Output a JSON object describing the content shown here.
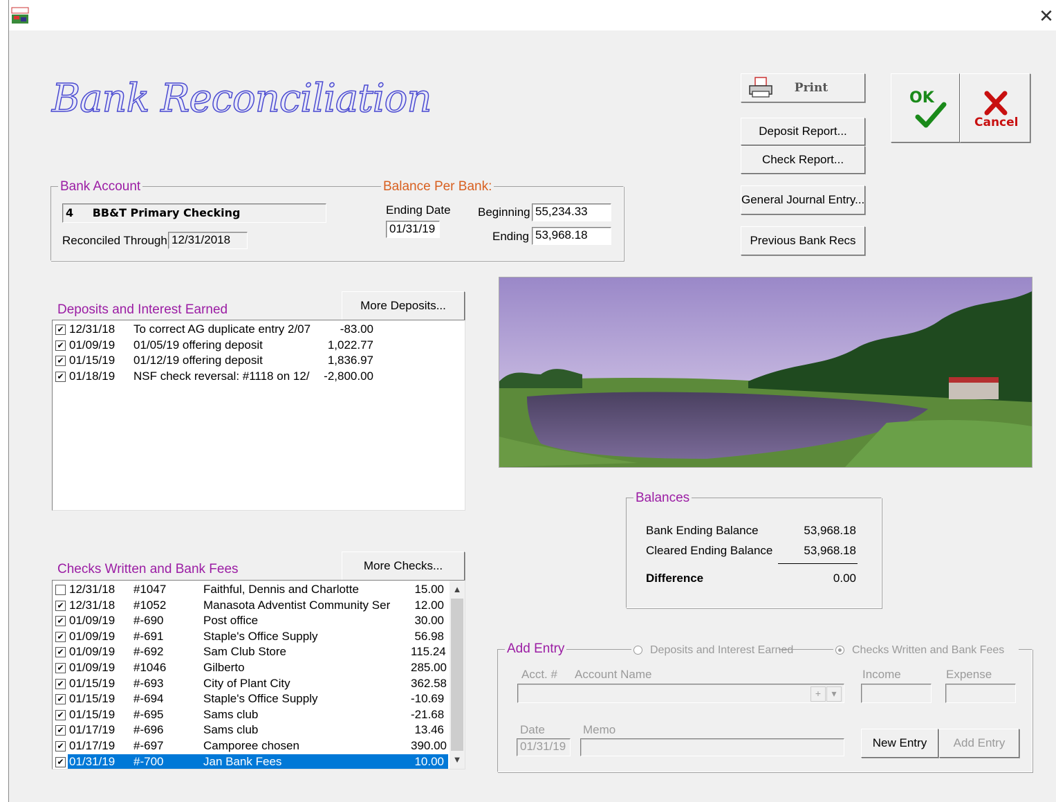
{
  "window": {
    "title": "Bank Reconciliation",
    "close_glyph": "✕"
  },
  "bank_account": {
    "legend": "Bank Account",
    "number": "4",
    "name": "BB&T Primary Checking",
    "reconciled_label": "Reconciled Through",
    "reconciled_value": "12/31/2018"
  },
  "balance_per_bank": {
    "legend": "Balance Per Bank:",
    "ending_date_label": "Ending Date",
    "ending_date_value": "01/31/19",
    "beginning_label": "Beginning",
    "beginning_value": "55,234.33",
    "ending_label": "Ending",
    "ending_value": "53,968.18"
  },
  "buttons": {
    "print": "Print",
    "deposit_report": "Deposit Report...",
    "check_report": "Check Report...",
    "general_journal": "General Journal Entry...",
    "previous_recs": "Previous Bank Recs",
    "ok": "OK",
    "cancel": "Cancel",
    "more_deposits": "More Deposits...",
    "more_checks": "More Checks...",
    "new_entry": "New Entry",
    "add_entry": "Add Entry"
  },
  "deposits": {
    "title": "Deposits and Interest Earned",
    "rows": [
      {
        "checked": true,
        "date": "12/31/18",
        "desc": "To correct AG duplicate entry 2/07",
        "amount": "-83.00"
      },
      {
        "checked": true,
        "date": "01/09/19",
        "desc": "01/05/19 offering deposit",
        "amount": "1,022.77"
      },
      {
        "checked": true,
        "date": "01/15/19",
        "desc": "01/12/19 offering deposit",
        "amount": "1,836.97"
      },
      {
        "checked": true,
        "date": "01/18/19",
        "desc": "NSF check reversal: #1118 on 12/",
        "amount": "-2,800.00"
      }
    ]
  },
  "checks": {
    "title": "Checks Written and Bank Fees",
    "rows": [
      {
        "checked": false,
        "date": "12/31/18",
        "num": "#1047",
        "payee": "Faithful, Dennis and Charlotte",
        "amount": "15.00"
      },
      {
        "checked": true,
        "date": "12/31/18",
        "num": "#1052",
        "payee": "Manasota Adventist Community Ser",
        "amount": "12.00"
      },
      {
        "checked": true,
        "date": "01/09/19",
        "num": "#-690",
        "payee": "Post office",
        "amount": "30.00"
      },
      {
        "checked": true,
        "date": "01/09/19",
        "num": "#-691",
        "payee": "Staple's Office Supply",
        "amount": "56.98"
      },
      {
        "checked": true,
        "date": "01/09/19",
        "num": "#-692",
        "payee": "Sam Club Store",
        "amount": "115.24"
      },
      {
        "checked": true,
        "date": "01/09/19",
        "num": "#1046",
        "payee": "Gilberto",
        "amount": "285.00"
      },
      {
        "checked": true,
        "date": "01/15/19",
        "num": "#-693",
        "payee": "City of Plant City",
        "amount": "362.58"
      },
      {
        "checked": true,
        "date": "01/15/19",
        "num": "#-694",
        "payee": "Staple's Office Supply",
        "amount": "-10.69"
      },
      {
        "checked": true,
        "date": "01/15/19",
        "num": "#-695",
        "payee": "Sams club",
        "amount": "-21.68"
      },
      {
        "checked": true,
        "date": "01/17/19",
        "num": "#-696",
        "payee": "Sams club",
        "amount": "13.46"
      },
      {
        "checked": true,
        "date": "01/17/19",
        "num": "#-697",
        "payee": "Camporee chosen",
        "amount": "390.00"
      },
      {
        "checked": true,
        "date": "01/31/19",
        "num": "#-700",
        "payee": "Jan Bank Fees",
        "amount": "10.00",
        "selected": true
      }
    ]
  },
  "balances": {
    "legend": "Balances",
    "bank_ending_label": "Bank Ending Balance",
    "bank_ending_value": "53,968.18",
    "cleared_ending_label": "Cleared Ending Balance",
    "cleared_ending_value": "53,968.18",
    "difference_label": "Difference",
    "difference_value": "0.00"
  },
  "add_entry": {
    "legend": "Add Entry",
    "radio_deposits": "Deposits and Interest Earned",
    "radio_checks": "Checks Written and Bank Fees",
    "acct_label": "Acct. #",
    "account_name_label": "Account Name",
    "income_label": "Income",
    "expense_label": "Expense",
    "date_label": "Date",
    "date_value": "01/31/19",
    "memo_label": "Memo",
    "plus_glyph": "+",
    "dropdown_glyph": "▾"
  },
  "colors": {
    "legend_purple": "#9b1da4",
    "legend_orange": "#d86020",
    "selection": "#0078d7",
    "title_blue": "#4a4ad0"
  },
  "icons": [
    "app-icon",
    "close-icon",
    "printer-icon",
    "ok-checkmark-icon",
    "cancel-x-icon",
    "checkbox-icon",
    "scroll-up-icon",
    "scroll-down-icon",
    "landscape-photo"
  ]
}
